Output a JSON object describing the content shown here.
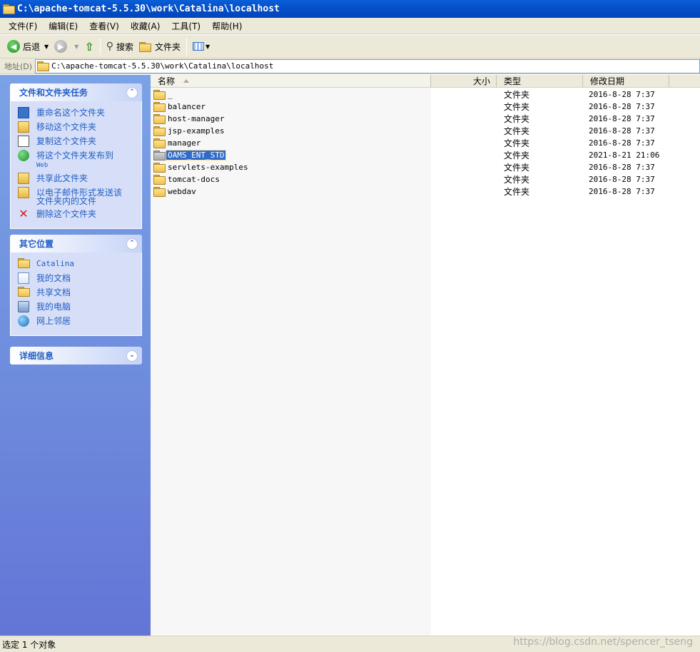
{
  "window": {
    "title": "C:\\apache-tomcat-5.5.30\\work\\Catalina\\localhost"
  },
  "menu": [
    "文件(F)",
    "编辑(E)",
    "查看(V)",
    "收藏(A)",
    "工具(T)",
    "帮助(H)"
  ],
  "toolbar": {
    "back_label": "后退",
    "search_label": "搜索",
    "folders_label": "文件夹"
  },
  "address": {
    "label": "地址(D)",
    "value": "C:\\apache-tomcat-5.5.30\\work\\Catalina\\localhost"
  },
  "tasks_panel": {
    "title": "文件和文件夹任务",
    "items": [
      {
        "label": "重命名这个文件夹",
        "icon": "rename-icon"
      },
      {
        "label": "移动这个文件夹",
        "icon": "move-icon"
      },
      {
        "label": "复制这个文件夹",
        "icon": "copy-icon"
      },
      {
        "label": "将这个文件夹发布到",
        "sub": "Web",
        "icon": "publish-web-icon"
      },
      {
        "label": "共享此文件夹",
        "icon": "share-icon"
      },
      {
        "label": "以电子邮件形式发送该文件夹内的文件",
        "icon": "email-icon"
      },
      {
        "label": "删除这个文件夹",
        "icon": "delete-icon"
      }
    ]
  },
  "other_places": {
    "title": "其它位置",
    "items": [
      {
        "label": "Catalina",
        "icon": "folder-icon"
      },
      {
        "label": "我的文档",
        "icon": "my-documents-icon"
      },
      {
        "label": "共享文档",
        "icon": "shared-documents-icon"
      },
      {
        "label": "我的电脑",
        "icon": "my-computer-icon"
      },
      {
        "label": "网上邻居",
        "icon": "network-places-icon"
      }
    ]
  },
  "details_panel": {
    "title": "详细信息"
  },
  "columns": {
    "name": "名称",
    "size": "大小",
    "type": "类型",
    "modified": "修改日期"
  },
  "files": [
    {
      "name": "_",
      "type": "文件夹",
      "modified": "2016-8-28 7:37",
      "selected": false
    },
    {
      "name": "balancer",
      "type": "文件夹",
      "modified": "2016-8-28 7:37",
      "selected": false
    },
    {
      "name": "host-manager",
      "type": "文件夹",
      "modified": "2016-8-28 7:37",
      "selected": false
    },
    {
      "name": "jsp-examples",
      "type": "文件夹",
      "modified": "2016-8-28 7:37",
      "selected": false
    },
    {
      "name": "manager",
      "type": "文件夹",
      "modified": "2016-8-28 7:37",
      "selected": false
    },
    {
      "name": "OAMS_ENT_STD",
      "type": "文件夹",
      "modified": "2021-8-21 21:06",
      "selected": true
    },
    {
      "name": "servlets-examples",
      "type": "文件夹",
      "modified": "2016-8-28 7:37",
      "selected": false
    },
    {
      "name": "tomcat-docs",
      "type": "文件夹",
      "modified": "2016-8-28 7:37",
      "selected": false
    },
    {
      "name": "webdav",
      "type": "文件夹",
      "modified": "2016-8-28 7:37",
      "selected": false
    }
  ],
  "status": {
    "text": "选定 1 个对象"
  },
  "watermark": "https://blog.csdn.net/spencer_tseng"
}
